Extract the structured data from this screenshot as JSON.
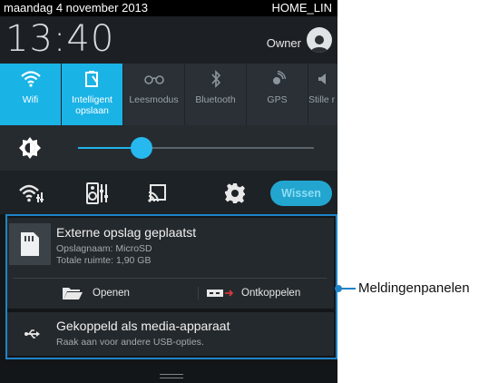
{
  "status_bar": {
    "date": "maandag 4 november 2013",
    "network": "HOME_LIN"
  },
  "header": {
    "clock": "13:40",
    "user": "Owner"
  },
  "quick_settings": [
    {
      "label": "Wifi",
      "icon": "wifi-icon",
      "active": true
    },
    {
      "label": "Intelligent opslaan",
      "icon": "smart-save-icon",
      "active": true
    },
    {
      "label": "Leesmodus",
      "icon": "reading-glasses-icon",
      "active": false
    },
    {
      "label": "Bluetooth",
      "icon": "bluetooth-icon",
      "active": false
    },
    {
      "label": "GPS",
      "icon": "gps-icon",
      "active": false
    },
    {
      "label": "Stille r",
      "icon": "mute-icon",
      "active": false
    }
  ],
  "brightness": {
    "level": 0.27
  },
  "tools": {
    "clear_label": "Wissen"
  },
  "notifications": {
    "storage": {
      "title": "Externe opslag geplaatst",
      "line1": "Opslagnaam: MicroSD",
      "line2": "Totale ruimte: 1,90 GB",
      "open_label": "Openen",
      "unmount_label": "Ontkoppelen"
    },
    "usb": {
      "title": "Gekoppeld als media-apparaat",
      "subtitle": "Raak aan voor andere USB-opties."
    }
  },
  "callout": {
    "label": "Meldingenpanelen"
  },
  "colors": {
    "accent": "#1ab3e6",
    "callout": "#1f84c6"
  }
}
